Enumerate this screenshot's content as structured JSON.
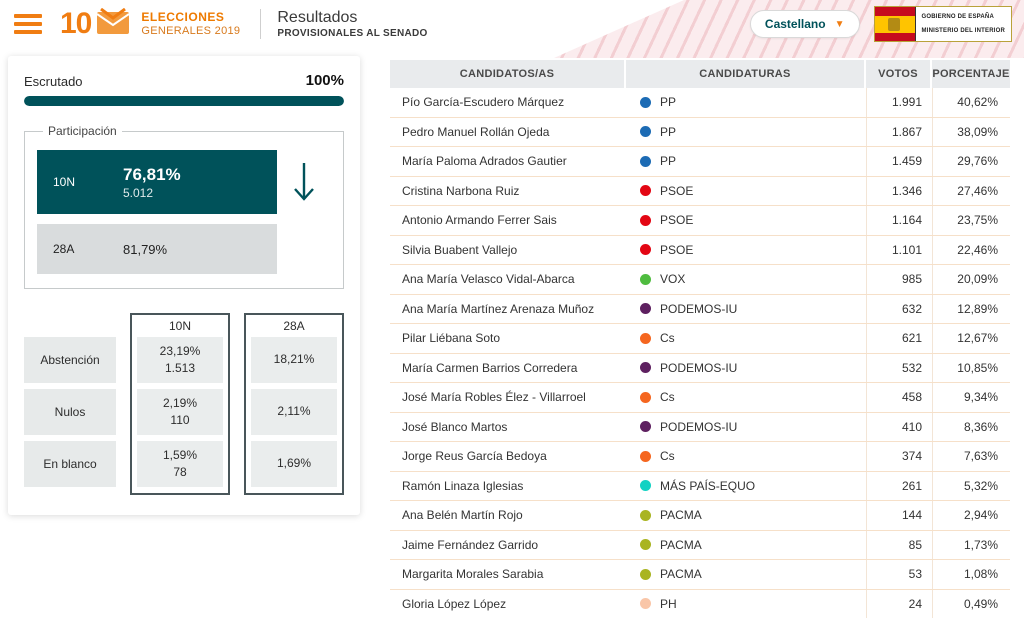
{
  "header": {
    "logo_number": "10",
    "logo_line1": "ELECCIONES",
    "logo_line2": "GENERALES 2019",
    "title": "Resultados",
    "subtitle": "PROVISIONALES AL SENADO",
    "language_selector": "Castellano",
    "chevron": "▼",
    "gov_line1": "GOBIERNO DE ESPAÑA",
    "gov_line2": "MINISTERIO DEL INTERIOR"
  },
  "colors": {
    "accent_teal": "#00525a",
    "accent_orange": "#f07d12",
    "progress": "100"
  },
  "left_panel": {
    "escrutado_label": "Escrutado",
    "escrutado_value": "100%",
    "participacion_label": "Participación",
    "participation": [
      {
        "label": "10N",
        "pct": "76,81%",
        "count": "5.012"
      },
      {
        "label": "28A",
        "pct": "81,79%"
      }
    ],
    "stats_columns": [
      "10N",
      "28A"
    ],
    "stats_rows": [
      {
        "label": "Abstención",
        "col1_pct": "23,19%",
        "col1_count": "1.513",
        "col2_pct": "18,21%"
      },
      {
        "label": "Nulos",
        "col1_pct": "2,19%",
        "col1_count": "110",
        "col2_pct": "2,11%"
      },
      {
        "label": "En blanco",
        "col1_pct": "1,59%",
        "col1_count": "78",
        "col2_pct": "1,69%"
      }
    ]
  },
  "results_table": {
    "headers": [
      "CANDIDATOS/AS",
      "CANDIDATURAS",
      "VOTOS",
      "PORCENTAJE"
    ],
    "rows": [
      {
        "name": "Pío García-Escudero Márquez",
        "party": "PP",
        "party_color": "#1c6bb4",
        "votes": "1.991",
        "pct": "40,62%"
      },
      {
        "name": "Pedro Manuel Rollán Ojeda",
        "party": "PP",
        "party_color": "#1c6bb4",
        "votes": "1.867",
        "pct": "38,09%"
      },
      {
        "name": "María Paloma Adrados Gautier",
        "party": "PP",
        "party_color": "#1c6bb4",
        "votes": "1.459",
        "pct": "29,76%"
      },
      {
        "name": "Cristina Narbona Ruiz",
        "party": "PSOE",
        "party_color": "#e30613",
        "votes": "1.346",
        "pct": "27,46%"
      },
      {
        "name": "Antonio Armando Ferrer Sais",
        "party": "PSOE",
        "party_color": "#e30613",
        "votes": "1.164",
        "pct": "23,75%"
      },
      {
        "name": "Silvia Buabent Vallejo",
        "party": "PSOE",
        "party_color": "#e30613",
        "votes": "1.101",
        "pct": "22,46%"
      },
      {
        "name": "Ana María Velasco Vidal-Abarca",
        "party": "VOX",
        "party_color": "#4fbc3f",
        "votes": "985",
        "pct": "20,09%"
      },
      {
        "name": "Ana María Martínez Arenaza Muñoz",
        "party": "PODEMOS-IU",
        "party_color": "#5e2060",
        "votes": "632",
        "pct": "12,89%"
      },
      {
        "name": "Pilar Liébana Soto",
        "party": "Cs",
        "party_color": "#f5661f",
        "votes": "621",
        "pct": "12,67%"
      },
      {
        "name": "María Carmen Barrios Corredera",
        "party": "PODEMOS-IU",
        "party_color": "#5e2060",
        "votes": "532",
        "pct": "10,85%"
      },
      {
        "name": "José María Robles Élez - Villarroel",
        "party": "Cs",
        "party_color": "#f5661f",
        "votes": "458",
        "pct": "9,34%"
      },
      {
        "name": "José Blanco Martos",
        "party": "PODEMOS-IU",
        "party_color": "#5e2060",
        "votes": "410",
        "pct": "8,36%"
      },
      {
        "name": "Jorge Reus García Bedoya",
        "party": "Cs",
        "party_color": "#f5661f",
        "votes": "374",
        "pct": "7,63%"
      },
      {
        "name": "Ramón Linaza Iglesias",
        "party": "MÁS PAÍS-EQUO",
        "party_color": "#12d2c3",
        "votes": "261",
        "pct": "5,32%"
      },
      {
        "name": "Ana Belén Martín Rojo",
        "party": "PACMA",
        "party_color": "#a9b421",
        "votes": "144",
        "pct": "2,94%"
      },
      {
        "name": "Jaime Fernández Garrido",
        "party": "PACMA",
        "party_color": "#a9b421",
        "votes": "85",
        "pct": "1,73%"
      },
      {
        "name": "Margarita Morales Sarabia",
        "party": "PACMA",
        "party_color": "#a9b421",
        "votes": "53",
        "pct": "1,08%"
      },
      {
        "name": "Gloria López López",
        "party": "PH",
        "party_color": "#f9c6a8",
        "votes": "24",
        "pct": "0,49%"
      }
    ]
  }
}
